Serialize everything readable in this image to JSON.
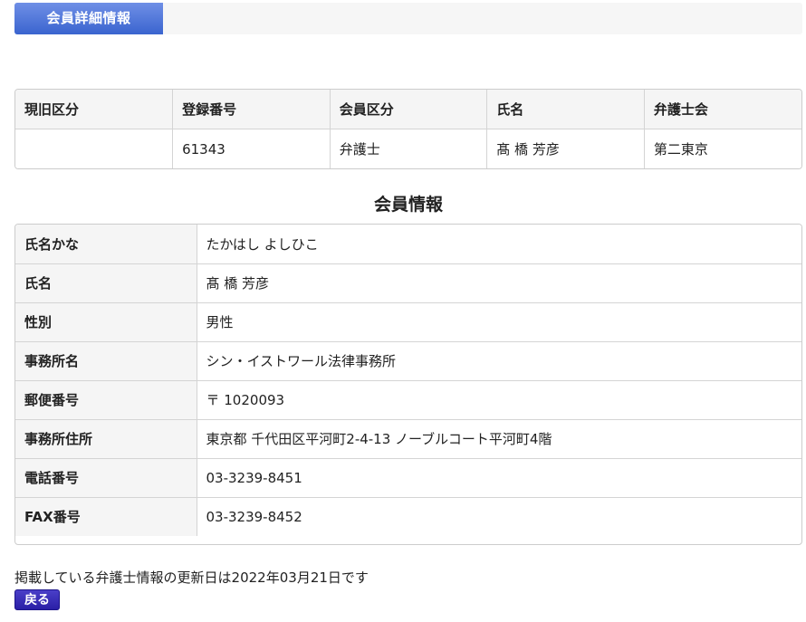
{
  "header": {
    "tab_label": "会員詳細情報"
  },
  "summary": {
    "headers": [
      "現旧区分",
      "登録番号",
      "会員区分",
      "氏名",
      "弁護士会"
    ],
    "values": [
      "",
      "61343",
      "弁護士",
      "髙 橋 芳彦",
      "第二東京"
    ]
  },
  "section_title": "会員情報",
  "details": [
    {
      "label": "氏名かな",
      "value": "たかはし よしひこ"
    },
    {
      "label": "氏名",
      "value": "髙 橋 芳彦"
    },
    {
      "label": "性別",
      "value": "男性"
    },
    {
      "label": "事務所名",
      "value": "シン・イストワール法律事務所"
    },
    {
      "label": "郵便番号",
      "value": "〒 1020093"
    },
    {
      "label": "事務所住所",
      "value": "東京都 千代田区平河町2-4-13 ノーブルコート平河町4階"
    },
    {
      "label": "電話番号",
      "value": "03-3239-8451"
    },
    {
      "label": "FAX番号",
      "value": "03-3239-8452"
    }
  ],
  "footer": {
    "update_note": "掲載している弁護士情報の更新日は2022年03月21日です",
    "back_label": "戻る"
  }
}
